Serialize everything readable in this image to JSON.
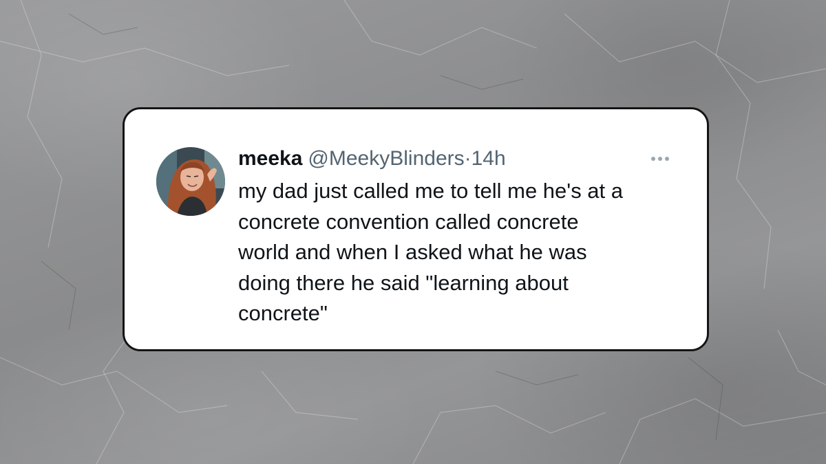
{
  "tweet": {
    "display_name": "meeka",
    "handle": "@MeekyBlinders",
    "separator": "·",
    "time": "14h",
    "more_icon": "more-dots-icon",
    "text_lines": [
      "my dad just called me to tell me he's at a",
      "concrete convention called concrete",
      "world and when I asked what he was",
      "doing there he said \"learning about",
      "concrete\""
    ]
  },
  "colors": {
    "card_background": "#ffffff",
    "card_border": "#141414",
    "text_primary": "#0f1419",
    "text_secondary": "#536471",
    "background_concrete": "#8f9091"
  },
  "avatar": {
    "icon": "user-avatar-photo"
  }
}
